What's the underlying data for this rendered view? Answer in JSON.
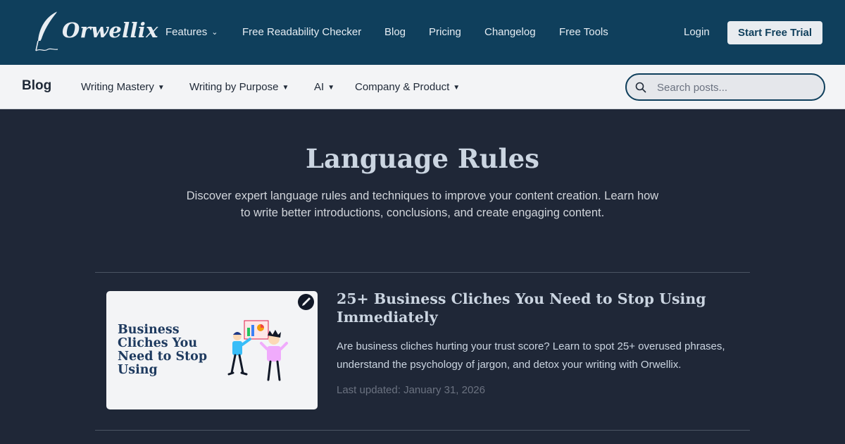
{
  "brand": {
    "name": "Orwellix"
  },
  "topnav": {
    "links": [
      "Features",
      "Free Readability Checker",
      "Blog",
      "Pricing",
      "Changelog",
      "Free Tools"
    ],
    "login": "Login",
    "cta": "Start Free Trial"
  },
  "subnav": {
    "title": "Blog",
    "categories": [
      "Writing Mastery",
      "Writing by Purpose",
      "AI",
      "Company & Product"
    ],
    "search_placeholder": "Search posts..."
  },
  "hero": {
    "title": "Language Rules",
    "description": "Discover expert language rules and techniques to improve your content creation. Learn how to write better introductions, conclusions, and create engaging content."
  },
  "posts": [
    {
      "thumbnail_text": "Business Cliches You Need to Stop Using",
      "title": "25+ Business Cliches You Need to Stop Using Immediately",
      "excerpt": "Are business cliches hurting your trust score? Learn to spot 25+ overused phrases, understand the psychology of jargon, and detox your writing with Orwellix.",
      "date": "Last updated: January 31, 2026"
    }
  ],
  "colors": {
    "header": "#0f3f5c",
    "page_bg": "#1f2737",
    "subnav_bg": "#f3f4f6"
  },
  "icons": [
    "quill-logo-icon",
    "chevron-down-icon",
    "caret-down-icon",
    "search-icon",
    "pen-icon"
  ]
}
